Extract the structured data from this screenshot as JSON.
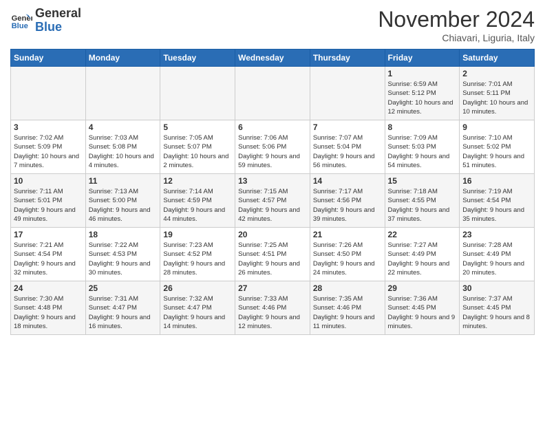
{
  "header": {
    "logo_line1": "General",
    "logo_line2": "Blue",
    "month": "November 2024",
    "location": "Chiavari, Liguria, Italy"
  },
  "days_of_week": [
    "Sunday",
    "Monday",
    "Tuesday",
    "Wednesday",
    "Thursday",
    "Friday",
    "Saturday"
  ],
  "weeks": [
    [
      {
        "day": "",
        "info": ""
      },
      {
        "day": "",
        "info": ""
      },
      {
        "day": "",
        "info": ""
      },
      {
        "day": "",
        "info": ""
      },
      {
        "day": "",
        "info": ""
      },
      {
        "day": "1",
        "info": "Sunrise: 6:59 AM\nSunset: 5:12 PM\nDaylight: 10 hours and 12 minutes."
      },
      {
        "day": "2",
        "info": "Sunrise: 7:01 AM\nSunset: 5:11 PM\nDaylight: 10 hours and 10 minutes."
      }
    ],
    [
      {
        "day": "3",
        "info": "Sunrise: 7:02 AM\nSunset: 5:09 PM\nDaylight: 10 hours and 7 minutes."
      },
      {
        "day": "4",
        "info": "Sunrise: 7:03 AM\nSunset: 5:08 PM\nDaylight: 10 hours and 4 minutes."
      },
      {
        "day": "5",
        "info": "Sunrise: 7:05 AM\nSunset: 5:07 PM\nDaylight: 10 hours and 2 minutes."
      },
      {
        "day": "6",
        "info": "Sunrise: 7:06 AM\nSunset: 5:06 PM\nDaylight: 9 hours and 59 minutes."
      },
      {
        "day": "7",
        "info": "Sunrise: 7:07 AM\nSunset: 5:04 PM\nDaylight: 9 hours and 56 minutes."
      },
      {
        "day": "8",
        "info": "Sunrise: 7:09 AM\nSunset: 5:03 PM\nDaylight: 9 hours and 54 minutes."
      },
      {
        "day": "9",
        "info": "Sunrise: 7:10 AM\nSunset: 5:02 PM\nDaylight: 9 hours and 51 minutes."
      }
    ],
    [
      {
        "day": "10",
        "info": "Sunrise: 7:11 AM\nSunset: 5:01 PM\nDaylight: 9 hours and 49 minutes."
      },
      {
        "day": "11",
        "info": "Sunrise: 7:13 AM\nSunset: 5:00 PM\nDaylight: 9 hours and 46 minutes."
      },
      {
        "day": "12",
        "info": "Sunrise: 7:14 AM\nSunset: 4:59 PM\nDaylight: 9 hours and 44 minutes."
      },
      {
        "day": "13",
        "info": "Sunrise: 7:15 AM\nSunset: 4:57 PM\nDaylight: 9 hours and 42 minutes."
      },
      {
        "day": "14",
        "info": "Sunrise: 7:17 AM\nSunset: 4:56 PM\nDaylight: 9 hours and 39 minutes."
      },
      {
        "day": "15",
        "info": "Sunrise: 7:18 AM\nSunset: 4:55 PM\nDaylight: 9 hours and 37 minutes."
      },
      {
        "day": "16",
        "info": "Sunrise: 7:19 AM\nSunset: 4:54 PM\nDaylight: 9 hours and 35 minutes."
      }
    ],
    [
      {
        "day": "17",
        "info": "Sunrise: 7:21 AM\nSunset: 4:54 PM\nDaylight: 9 hours and 32 minutes."
      },
      {
        "day": "18",
        "info": "Sunrise: 7:22 AM\nSunset: 4:53 PM\nDaylight: 9 hours and 30 minutes."
      },
      {
        "day": "19",
        "info": "Sunrise: 7:23 AM\nSunset: 4:52 PM\nDaylight: 9 hours and 28 minutes."
      },
      {
        "day": "20",
        "info": "Sunrise: 7:25 AM\nSunset: 4:51 PM\nDaylight: 9 hours and 26 minutes."
      },
      {
        "day": "21",
        "info": "Sunrise: 7:26 AM\nSunset: 4:50 PM\nDaylight: 9 hours and 24 minutes."
      },
      {
        "day": "22",
        "info": "Sunrise: 7:27 AM\nSunset: 4:49 PM\nDaylight: 9 hours and 22 minutes."
      },
      {
        "day": "23",
        "info": "Sunrise: 7:28 AM\nSunset: 4:49 PM\nDaylight: 9 hours and 20 minutes."
      }
    ],
    [
      {
        "day": "24",
        "info": "Sunrise: 7:30 AM\nSunset: 4:48 PM\nDaylight: 9 hours and 18 minutes."
      },
      {
        "day": "25",
        "info": "Sunrise: 7:31 AM\nSunset: 4:47 PM\nDaylight: 9 hours and 16 minutes."
      },
      {
        "day": "26",
        "info": "Sunrise: 7:32 AM\nSunset: 4:47 PM\nDaylight: 9 hours and 14 minutes."
      },
      {
        "day": "27",
        "info": "Sunrise: 7:33 AM\nSunset: 4:46 PM\nDaylight: 9 hours and 12 minutes."
      },
      {
        "day": "28",
        "info": "Sunrise: 7:35 AM\nSunset: 4:46 PM\nDaylight: 9 hours and 11 minutes."
      },
      {
        "day": "29",
        "info": "Sunrise: 7:36 AM\nSunset: 4:45 PM\nDaylight: 9 hours and 9 minutes."
      },
      {
        "day": "30",
        "info": "Sunrise: 7:37 AM\nSunset: 4:45 PM\nDaylight: 9 hours and 8 minutes."
      }
    ]
  ]
}
